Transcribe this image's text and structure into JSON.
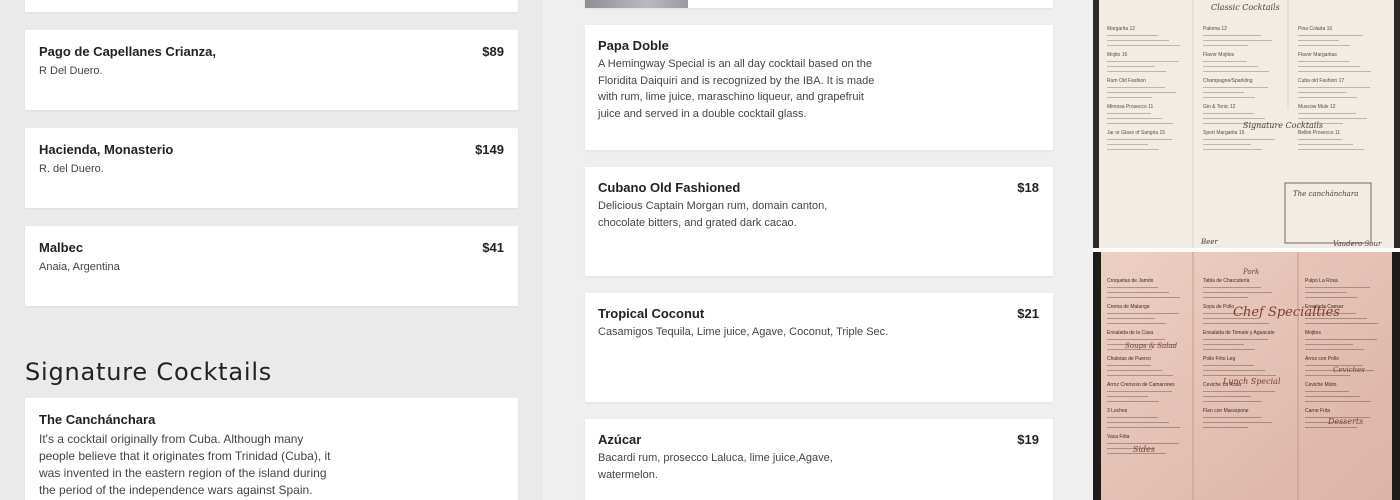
{
  "wines": [
    {
      "name": "Pago de Capellanes Crianza,",
      "desc": "R Del Duero.",
      "price": "$89"
    },
    {
      "name": "Hacienda, Monasterio",
      "desc": "R. del Duero.",
      "price": "$149"
    },
    {
      "name": "Malbec",
      "desc": "Anaia, Argentina",
      "price": "$41"
    }
  ],
  "signature": {
    "title": "Signature Cocktails",
    "card": {
      "name": "The Canchánchara",
      "desc": "It's a cocktail originally from Cuba. Although many people believe that it originates from Trinidad (Cuba), it was invented in the eastern region of the island during the period of the independence wars against Spain. Lime"
    }
  },
  "cocktails": [
    {
      "name": "Papa Doble",
      "desc": "A Hemingway Special is an all day cocktail based on the Floridita Daiquiri and is recognized by the IBA. It is made with rum, lime juice, maraschino liqueur, and grapefruit juice and served in a double cocktail glass.",
      "price": ""
    },
    {
      "name": "Cubano Old Fashioned",
      "desc": "Delicious Captain Morgan rum, domain canton, chocolate bitters, and grated dark cacao.",
      "price": "$18"
    },
    {
      "name": "Tropical Coconut",
      "desc": "Casamigos Tequila, Lime juice, Agave, Coconut, Triple Sec.",
      "price": "$21"
    },
    {
      "name": "Azúcar",
      "desc": "Bacardi rum, prosecco Laluca, lime juice,Agave, watermelon.",
      "price": "$19"
    }
  ],
  "photos": {
    "top": {
      "alt": "Menu photo – Classic Cocktails, Signature Cocktails",
      "headings": [
        "Classic Cocktails",
        "Signature Cocktails",
        "The canchánchara",
        "Beer",
        "Vaudero Sour"
      ],
      "lines": [
        "Margarita 12",
        "Paloma 12",
        "Pina Colada 16",
        "Mojito 16",
        "Flavor Mojitos",
        "Flavor Margaritas",
        "Rum Old Fashion",
        "Champagne/Sparkling",
        "Cuba old Fashion 17",
        "Mimosa Prosecco 11",
        "Gin & Tonic 12",
        "Muscow Mule 12",
        "Jar or Glass of Sangria 15",
        "Sport Margarita 15",
        "Bellini Prosecco 11"
      ]
    },
    "bottom": {
      "alt": "Menu photo – Chef Specialties, Lunch Special",
      "headings": [
        "Chef Specialties",
        "Lunch Special",
        "Soups & Salad",
        "Pork",
        "Ceviches",
        "Desserts",
        "Sides"
      ],
      "lines": [
        "Croquetas de Jamón",
        "Tabla de Charcutería",
        "Pulpo La Rosa",
        "Crema de Malanga",
        "Sopa de Pollo",
        "Ensalada Caesar",
        "Ensalada de la Casa",
        "Ensalada de Tomate y Aguacate",
        "Mojitos",
        "Chuletas de Puerco",
        "Pollo Frito Leg",
        "Arroz con Pollo",
        "Arroz Cremoso de Camarones",
        "Ceviche La Rosa",
        "Ceviche Mixto",
        "3 Leches",
        "Flan con Macarpone",
        "Carne Frita",
        "Vaca Frita"
      ]
    }
  }
}
